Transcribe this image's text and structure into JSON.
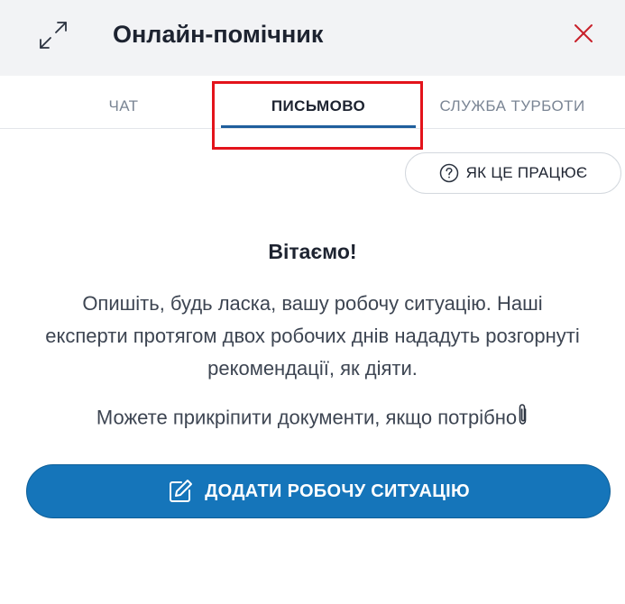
{
  "header": {
    "title": "Онлайн-помічник",
    "expand_icon": "expand-arrows-icon",
    "close_icon": "close-icon",
    "close_color": "#c8202a"
  },
  "tabs": [
    {
      "label": "ЧАТ",
      "active": false
    },
    {
      "label": "ПИСЬМОВО",
      "active": true
    },
    {
      "label": "СЛУЖБА ТУРБОТИ",
      "active": false
    }
  ],
  "how_it_works": {
    "label": "ЯК ЦЕ ПРАЦЮЄ",
    "icon": "question-circle-icon"
  },
  "content": {
    "greeting": "Вітаємо!",
    "description": "Опишіть, будь ласка, вашу робочу ситуацію. Наші експерти протягом двох робочих днів нададуть розгорнуті рекомендації, як діяти.",
    "attach_note": "Можете прикріпити документи, якщо потрібно",
    "attach_icon": "paperclip-icon"
  },
  "add_button": {
    "label": "ДОДАТИ РОБОЧУ СИТУАЦІЮ",
    "icon": "edit-icon",
    "color": "#1575ba"
  },
  "accent_colors": {
    "active_tab_underline": "#1f5f9d",
    "highlight_frame": "#e3131b"
  }
}
